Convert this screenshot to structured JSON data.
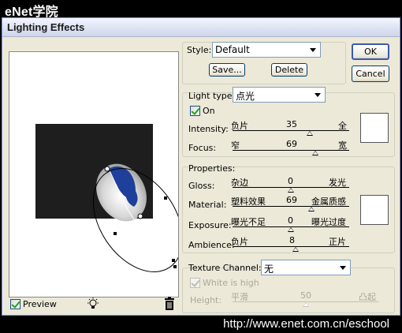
{
  "banner": {
    "title": "eNet学院"
  },
  "footer": {
    "url": "http://www.enet.com.cn/eschool"
  },
  "dialog": {
    "title": "Lighting Effects"
  },
  "preview": {
    "checkbox_label": "Preview",
    "checked": true
  },
  "style": {
    "label": "Style:",
    "selected": "Default",
    "save_label": "Save...",
    "delete_label": "Delete"
  },
  "buttons": {
    "ok": "OK",
    "cancel": "Cancel"
  },
  "light_type": {
    "label": "Light type:",
    "selected": "点光",
    "on_label": "On",
    "on_checked": true,
    "color": "#ffffff",
    "sliders": [
      {
        "label": "Intensity:",
        "left": "负片",
        "value": "35",
        "right": "全"
      },
      {
        "label": "Focus:",
        "left": "窄",
        "value": "69",
        "right": "宽"
      }
    ]
  },
  "properties": {
    "label": "Properties:",
    "color": "#ffffff",
    "sliders": [
      {
        "label": "Gloss:",
        "left": "杂边",
        "value": "0",
        "right": "发光"
      },
      {
        "label": "Material:",
        "left": "塑料效果",
        "value": "69",
        "right": "金属质感"
      },
      {
        "label": "Exposure:",
        "left": "曝光不足",
        "value": "0",
        "right": "曝光过度"
      },
      {
        "label": "Ambience:",
        "left": "负片",
        "value": "8",
        "right": "正片"
      }
    ]
  },
  "texture": {
    "label": "Texture Channel:",
    "selected": "无",
    "white_is_high_label": "White is high",
    "white_is_high_checked": true,
    "height": {
      "label": "Height:",
      "left": "平滑",
      "value": "50",
      "right": "凸起"
    }
  },
  "colors": {
    "dialog_bg": "#ece9d8",
    "canvas_dark": "#1e1e1e",
    "light_blue": "#1e3f9a",
    "border_blue": "#7f9db9"
  }
}
